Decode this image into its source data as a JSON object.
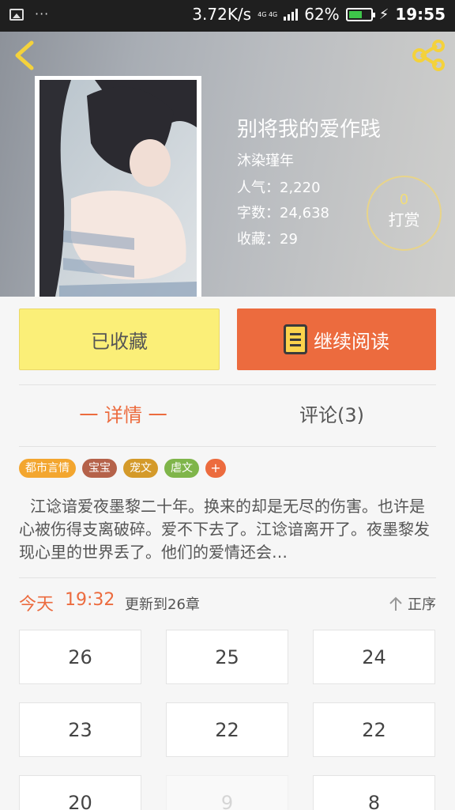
{
  "status_bar": {
    "speed": "3.72K/s",
    "network": "4G 4G",
    "battery": "62%",
    "time": "19:55"
  },
  "book": {
    "title": "别将我的爱作践",
    "author": "沐染瑾年",
    "popularity": "人气：2,220",
    "words": "字数：24,638",
    "favorites": "收藏：29"
  },
  "tip": {
    "count": "0",
    "label": "打赏"
  },
  "actions": {
    "favorite_label": "已收藏",
    "read_label": "继续阅读"
  },
  "tabs": {
    "detail": "一 详情 一",
    "comments": "评论(3)"
  },
  "tags": [
    {
      "label": "都市言情",
      "color": "#f3a62f"
    },
    {
      "label": "宝宝",
      "color": "#b5624a"
    },
    {
      "label": "宠文",
      "color": "#d49a2a"
    },
    {
      "label": "虐文",
      "color": "#7fb54a"
    }
  ],
  "tag_add": "+",
  "description": "江谂谙爱夜墨黎二十年。换来的却是无尽的伤害。也许是心被伤得支离破碎。爱不下去了。江谂谙离开了。夜墨黎发现心里的世界丢了。他们的爱情还会…",
  "update": {
    "today": "今天",
    "time": "19:32",
    "text": "更新到26章"
  },
  "sort_label": "正序",
  "chapters": [
    "26",
    "25",
    "24",
    "23",
    "22",
    "22",
    "20",
    "9",
    "8"
  ],
  "colors": {
    "accent": "#ec6b3e",
    "favorite_bg": "#fbef78"
  }
}
